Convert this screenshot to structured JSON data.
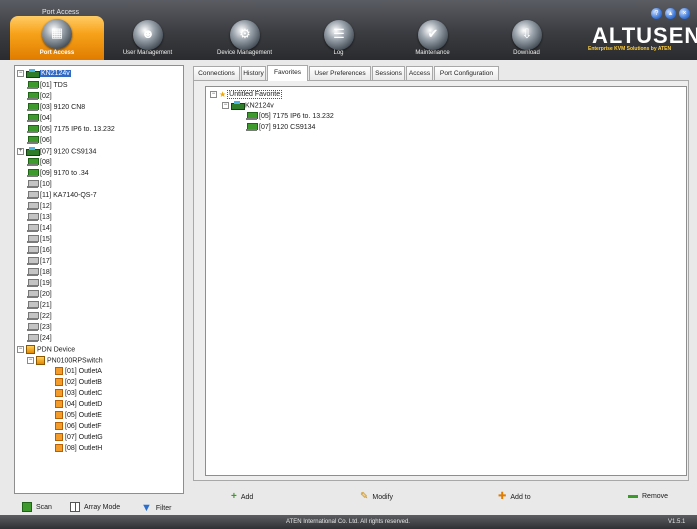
{
  "app": {
    "title": "Port Access",
    "brand": "ALTUSEN",
    "brand_tagline": "Enterprise KVM Solutions by ATEN",
    "footer_text": "ATEN International Co. Ltd. All rights reserved.",
    "version": "V1.5.1"
  },
  "nav": [
    {
      "label": "Port Access",
      "icon": "port-access-icon"
    },
    {
      "label": "User Management",
      "icon": "user-management-icon"
    },
    {
      "label": "Device Management",
      "icon": "device-management-icon"
    },
    {
      "label": "Log",
      "icon": "log-icon"
    },
    {
      "label": "Maintenance",
      "icon": "maintenance-icon"
    },
    {
      "label": "Download",
      "icon": "download-icon"
    }
  ],
  "window_controls": [
    "?",
    "▴",
    "×"
  ],
  "tree": {
    "root": "KN2124v",
    "ports": [
      "[01] TDS",
      "[02]",
      "[03] 9120 CN8",
      "[04]",
      "[05] 7175 IP6 to. 13.232",
      "[06]",
      "[07] 9120 CS9134",
      "[08]",
      "[09] 9170 to .34",
      "[10]",
      "[11] KA7140-QS-7",
      "[12]",
      "[13]",
      "[14]",
      "[15]",
      "[16]",
      "[17]",
      "[18]",
      "[19]",
      "[20]",
      "[21]",
      "[22]",
      "[23]",
      "[24]"
    ],
    "pdn_group": "PDN Device",
    "pdn_switch": "PN0100RPSwitch",
    "outlets": [
      "[01] OutletA",
      "[02] OutletB",
      "[03] OutletC",
      "[04] OutletD",
      "[05] OutletE",
      "[06] OutletF",
      "[07] OutletG",
      "[08] OutletH"
    ]
  },
  "left_buttons": {
    "scan": "Scan",
    "array_mode": "Array Mode",
    "filter": "Filter"
  },
  "tabs": [
    "Connections",
    "History",
    "Favorites",
    "User Preferences",
    "Sessions",
    "Access",
    "Port Configuration"
  ],
  "active_tab": "Favorites",
  "favorites": {
    "root": "Untitled Favorite",
    "device": "KN2124v",
    "items": [
      "[05] 7175 IP6 to. 13.232",
      "[07] 9120 CS9134"
    ]
  },
  "bottom_buttons": {
    "add": "Add",
    "modify": "Modify",
    "add_to": "Add to",
    "remove": "Remove"
  }
}
